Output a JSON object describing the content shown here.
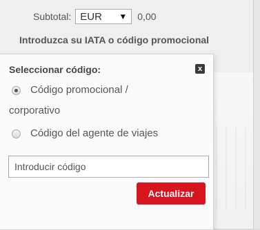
{
  "subtotal": {
    "label": "Subtotal:",
    "currency": "EUR",
    "amount": "0,00"
  },
  "promo_heading": "Introduzca su IATA o código promocional",
  "popup": {
    "title": "Seleccionar código:",
    "close_label": "x",
    "options": [
      {
        "label_line1": "Código promocional /",
        "label_line2": "corporativo",
        "checked": true
      },
      {
        "label_line1": "Código del agente de viajes",
        "checked": false
      }
    ],
    "code_input": {
      "placeholder": "Introducir código",
      "value": ""
    },
    "update_label": "Actualizar"
  },
  "colors": {
    "accent": "#d8141f",
    "close_bg": "#3a3a3a"
  }
}
